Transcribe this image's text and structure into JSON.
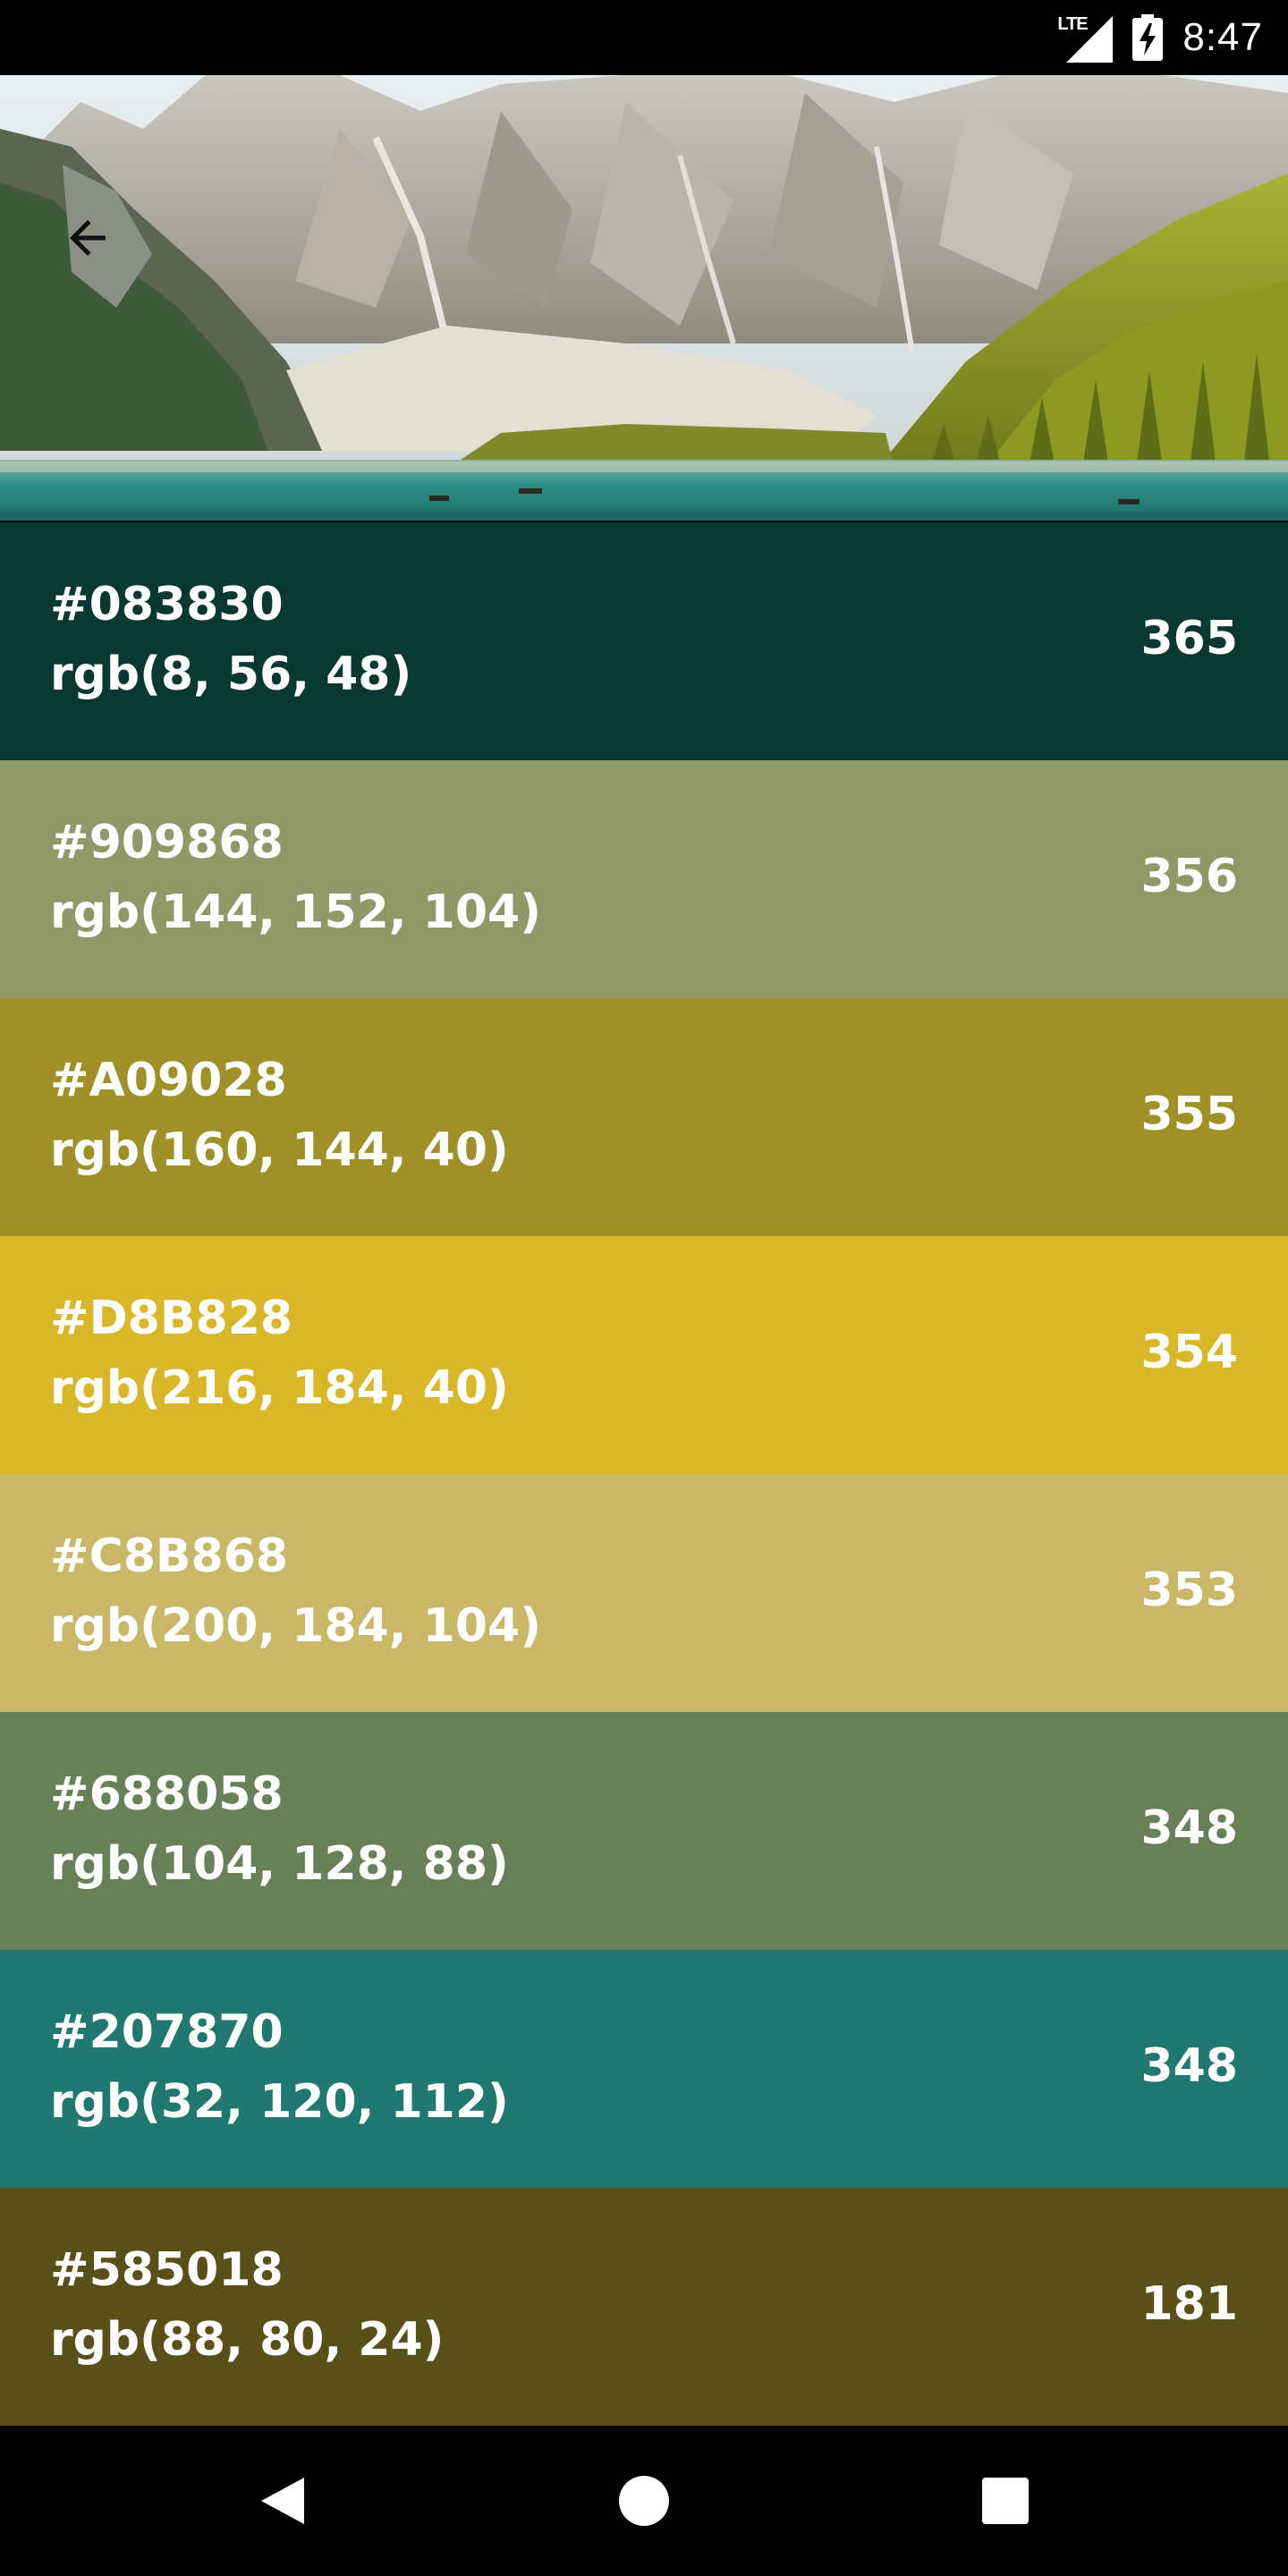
{
  "status_bar": {
    "network": "LTE",
    "time": "8:47"
  },
  "header": {
    "image": "mountain-lake-landscape",
    "back_icon": "arrow-back-icon"
  },
  "swatches": [
    {
      "hex": "#083830",
      "rgb": "rgb(8, 56, 48)",
      "count": "365",
      "color": "#083830"
    },
    {
      "hex": "#909868",
      "rgb": "rgb(144, 152, 104)",
      "count": "356",
      "color": "#909868"
    },
    {
      "hex": "#A09028",
      "rgb": "rgb(160, 144, 40)",
      "count": "355",
      "color": "#A09028"
    },
    {
      "hex": "#D8B828",
      "rgb": "rgb(216, 184, 40)",
      "count": "354",
      "color": "#D8B828"
    },
    {
      "hex": "#C8B868",
      "rgb": "rgb(200, 184, 104)",
      "count": "353",
      "color": "#C8B868"
    },
    {
      "hex": "#688058",
      "rgb": "rgb(104, 128, 88)",
      "count": "348",
      "color": "#688058"
    },
    {
      "hex": "#207870",
      "rgb": "rgb(32, 120, 112)",
      "count": "348",
      "color": "#207870"
    },
    {
      "hex": "#585018",
      "rgb": "rgb(88, 80, 24)",
      "count": "181",
      "color": "#585018"
    }
  ],
  "nav_bar": {
    "back_icon": "nav-back-icon",
    "home_icon": "nav-home-icon",
    "recents_icon": "nav-recents-icon"
  }
}
